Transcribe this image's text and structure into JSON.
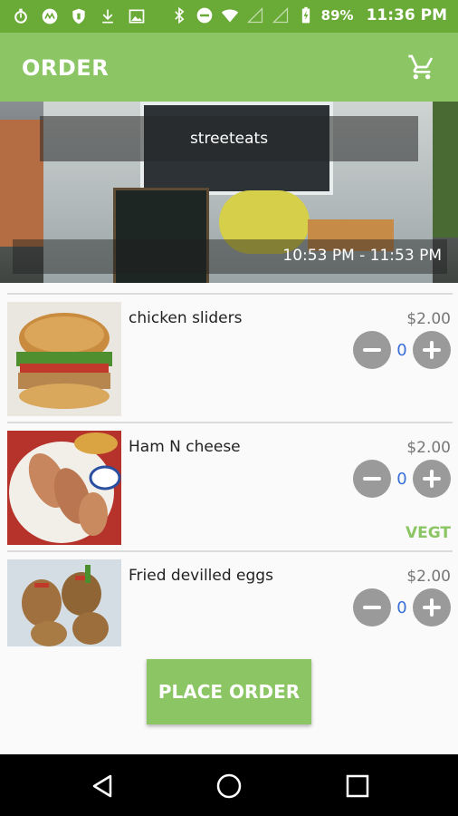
{
  "status_bar": {
    "icons_left": [
      "stopwatch-icon",
      "moto-icon",
      "shield-icon",
      "download-icon",
      "image-icon"
    ],
    "icons_right": [
      "bluetooth-icon",
      "do-not-disturb-icon",
      "wifi-icon",
      "signal-icon",
      "signal-icon",
      "battery-icon"
    ],
    "battery": "89%",
    "time": "11:36 PM"
  },
  "app_bar": {
    "title": "ORDER",
    "cart_icon": "cart-icon"
  },
  "vendor": {
    "name": "streeteats",
    "hours": "10:53 PM - 11:53 PM"
  },
  "menu_items": [
    {
      "name": "chicken sliders",
      "price": "$2.00",
      "quantity": "0",
      "tag": ""
    },
    {
      "name": "Ham N cheese",
      "price": "$2.00",
      "quantity": "0",
      "tag": "VEGT"
    },
    {
      "name": "Fried devilled eggs",
      "price": "$2.00",
      "quantity": "0",
      "tag": ""
    }
  ],
  "actions": {
    "place_order": "PLACE ORDER"
  },
  "nav": [
    "back-icon",
    "home-icon",
    "recents-icon"
  ],
  "colors": {
    "status_bar": "#6aaa36",
    "app_bar": "#8bc564",
    "accent": "#8bc564",
    "qty_text": "#3a6fd8"
  }
}
